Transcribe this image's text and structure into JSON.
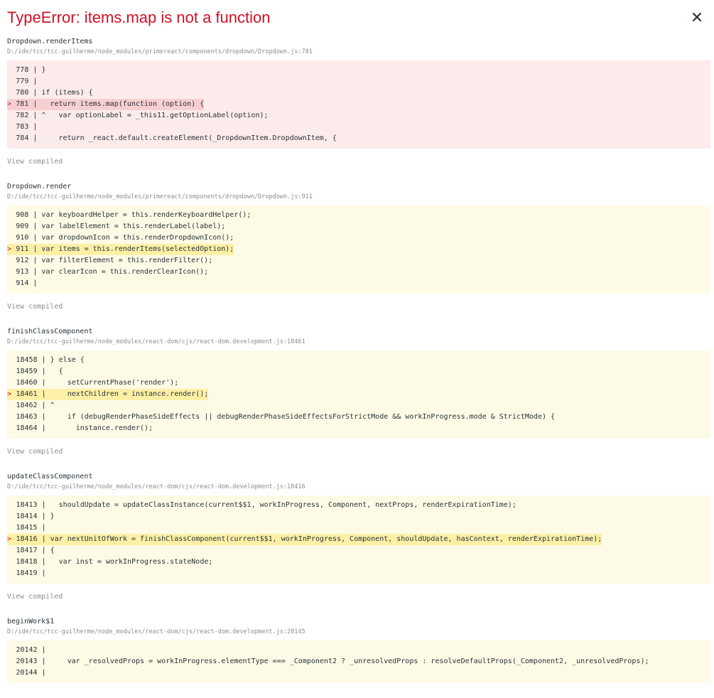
{
  "error": {
    "title": "TypeError: items.map is not a function"
  },
  "close": {
    "label": "×"
  },
  "frames": [
    {
      "function": "Dropdown.renderItems",
      "location": "D:/ide/tcc/tcc-guilherme/node_modules/primereact/components/dropdown/Dropdown.js:781",
      "kind": "err",
      "lines": [
        {
          "num": "778",
          "text": "}",
          "hl": false
        },
        {
          "num": "779",
          "text": "",
          "hl": false
        },
        {
          "num": "780",
          "text": "if (items) {",
          "hl": false
        },
        {
          "num": "781",
          "text": "  return items.map(function (option) {",
          "hl": true
        },
        {
          "num": "782",
          "caret": "^",
          "text": "   var optionLabel = _this11.getOptionLabel(option);",
          "hl": false
        },
        {
          "num": "783",
          "text": "",
          "hl": false
        },
        {
          "num": "784",
          "text": "    return _react.default.createElement(_DropdownItem.DropdownItem, {",
          "hl": false
        }
      ],
      "view": "View compiled"
    },
    {
      "function": "Dropdown.render",
      "location": "D:/ide/tcc/tcc-guilherme/node_modules/primereact/components/dropdown/Dropdown.js:911",
      "kind": "warn",
      "lines": [
        {
          "num": "908",
          "text": "var keyboardHelper = this.renderKeyboardHelper();",
          "hl": false
        },
        {
          "num": "909",
          "text": "var labelElement = this.renderLabel(label);",
          "hl": false
        },
        {
          "num": "910",
          "text": "var dropdownIcon = this.renderDropdownIcon();",
          "hl": false
        },
        {
          "num": "911",
          "text": "var items = this.renderItems(selectedOption);",
          "hl": true
        },
        {
          "num": "912",
          "text": "var filterElement = this.renderFilter();",
          "hl": false
        },
        {
          "num": "913",
          "text": "var clearIcon = this.renderClearIcon();",
          "hl": false
        },
        {
          "num": "914",
          "text": "",
          "hl": false
        }
      ],
      "view": "View compiled"
    },
    {
      "function": "finishClassComponent",
      "location": "D:/ide/tcc/tcc-guilherme/node_modules/react-dom/cjs/react-dom.development.js:18461",
      "kind": "warn",
      "lines": [
        {
          "num": "18458",
          "text": "} else {",
          "hl": false
        },
        {
          "num": "18459",
          "text": "  {",
          "hl": false
        },
        {
          "num": "18460",
          "text": "    setCurrentPhase('render');",
          "hl": false
        },
        {
          "num": "18461",
          "text": "    nextChildren = instance.render();",
          "hl": true
        },
        {
          "num": "18462",
          "caret": "^",
          "text": "",
          "hl": false
        },
        {
          "num": "18463",
          "text": "    if (debugRenderPhaseSideEffects || debugRenderPhaseSideEffectsForStrictMode && workInProgress.mode & StrictMode) {",
          "hl": false
        },
        {
          "num": "18464",
          "text": "      instance.render();",
          "hl": false
        }
      ],
      "view": "View compiled"
    },
    {
      "function": "updateClassComponent",
      "location": "D:/ide/tcc/tcc-guilherme/node_modules/react-dom/cjs/react-dom.development.js:18416",
      "kind": "warn",
      "lines": [
        {
          "num": "18413",
          "text": "  shouldUpdate = updateClassInstance(current$$1, workInProgress, Component, nextProps, renderExpirationTime);",
          "hl": false
        },
        {
          "num": "18414",
          "text": "}",
          "hl": false
        },
        {
          "num": "18415",
          "text": "",
          "hl": false
        },
        {
          "num": "18416",
          "text": "var nextUnitOfWork = finishClassComponent(current$$1, workInProgress, Component, shouldUpdate, hasContext, renderExpirationTime);",
          "hl": true
        },
        {
          "num": "18417",
          "text": "{",
          "hl": false
        },
        {
          "num": "18418",
          "text": "  var inst = workInProgress.stateNode;",
          "hl": false
        },
        {
          "num": "18419",
          "text": "",
          "hl": false
        }
      ],
      "view": "View compiled"
    },
    {
      "function": "beginWork$1",
      "location": "D:/ide/tcc/tcc-guilherme/node_modules/react-dom/cjs/react-dom.development.js:20145",
      "kind": "warn",
      "lines": [
        {
          "num": "20142",
          "text": "",
          "hl": false
        },
        {
          "num": "20143",
          "text": "    var _resolvedProps = workInProgress.elementType === _Component2 ? _unresolvedProps : resolveDefaultProps(_Component2, _unresolvedProps);",
          "hl": false
        },
        {
          "num": "20144",
          "text": "",
          "hl": false
        }
      ],
      "view": ""
    }
  ]
}
